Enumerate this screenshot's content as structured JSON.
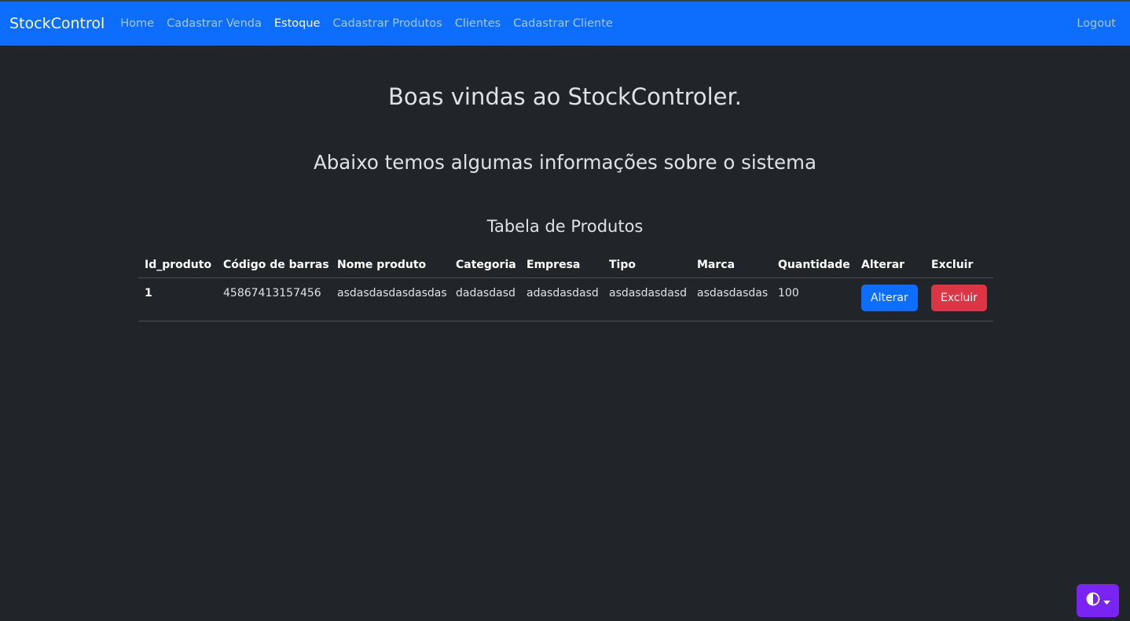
{
  "navbar": {
    "brand": "StockControl",
    "links": [
      {
        "label": "Home",
        "active": false
      },
      {
        "label": "Cadastrar Venda",
        "active": false
      },
      {
        "label": "Estoque",
        "active": true
      },
      {
        "label": "Cadastrar Produtos",
        "active": false
      },
      {
        "label": "Clientes",
        "active": false
      },
      {
        "label": "Cadastrar Cliente",
        "active": false
      }
    ],
    "logout": "Logout"
  },
  "main": {
    "welcome": "Boas vindas ao StockControler.",
    "subtitle": "Abaixo temos algumas informações sobre o sistema",
    "table_title": "Tabela de Produtos"
  },
  "table": {
    "headers": [
      "Id_produto",
      "Código de barras",
      "Nome produto",
      "Categoria",
      "Empresa",
      "Tipo",
      "Marca",
      "Quantidade",
      "Alterar",
      "Excluir"
    ],
    "rows": [
      {
        "id": "1",
        "barcode": "45867413157456",
        "name": "asdasdasdasdasdas",
        "category": "dadasdasd",
        "company": "adasdasdasd",
        "type": "asdasdasdasd",
        "brand": "asdasdasdas",
        "quantity": "100",
        "edit_label": "Alterar",
        "delete_label": "Excluir"
      }
    ]
  },
  "theme_toggle": {
    "icon": "contrast-icon",
    "color": "#7a24f3"
  },
  "colors": {
    "navbar": "#0d6efd",
    "background": "#212529",
    "primary": "#0d6efd",
    "danger": "#dc3545"
  }
}
